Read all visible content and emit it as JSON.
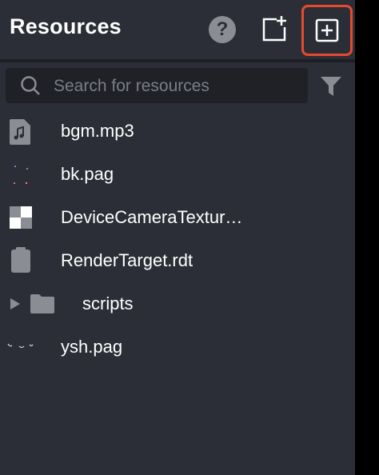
{
  "header": {
    "title": "Resources",
    "help_glyph": "?"
  },
  "search": {
    "placeholder": "Search for resources"
  },
  "icons": {
    "help": "question-circle-icon",
    "new_folder": "new-folder-icon",
    "add": "plus-square-icon",
    "search": "search-icon",
    "filter": "filter-icon"
  },
  "colors": {
    "panel_bg": "#2b2e36",
    "highlight_border": "#e64a2e",
    "text": "#ffffff",
    "muted": "#7a7e86"
  },
  "items": [
    {
      "label": "bgm.mp3",
      "icon": "audio-file-icon"
    },
    {
      "label": "bk.pag",
      "icon": "pag-file-icon"
    },
    {
      "label": "DeviceCameraTextur…",
      "icon": "texture-icon"
    },
    {
      "label": "RenderTarget.rdt",
      "icon": "render-target-icon"
    },
    {
      "label": "scripts",
      "icon": "folder-icon",
      "expander": "collapsed"
    },
    {
      "label": "ysh.pag",
      "icon": "pag-file-icon"
    }
  ]
}
